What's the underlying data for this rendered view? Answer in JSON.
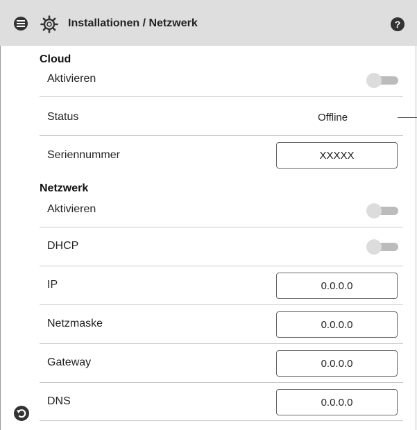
{
  "header": {
    "title": "Installationen / Netzwerk",
    "help_label": "?",
    "menu_icon": "hamburger-circle-icon",
    "settings_icon": "gear-icon",
    "help_icon": "question-circle-icon"
  },
  "cloud": {
    "section_title": "Cloud",
    "activate_label": "Aktivieren",
    "activate_on": false,
    "status_label": "Status",
    "status_value": "Offline",
    "serial_label": "Seriennummer",
    "serial_value": "XXXXX"
  },
  "network": {
    "section_title": "Netzwerk",
    "activate_label": "Aktivieren",
    "activate_on": false,
    "dhcp_label": "DHCP",
    "dhcp_on": false,
    "ip_label": "IP",
    "ip_value": "0.0.0.0",
    "netmask_label": "Netzmaske",
    "netmask_value": "0.0.0.0",
    "gateway_label": "Gateway",
    "gateway_value": "0.0.0.0",
    "dns_label": "DNS",
    "dns_value": "0.0.0.0"
  },
  "footer": {
    "back_icon": "back-arrow-icon"
  },
  "colors": {
    "header_bg": "#dedede",
    "toggle_off_track": "#bcbcbc",
    "toggle_off_knob": "#dcdcdc",
    "divider": "#c8c8c8"
  }
}
